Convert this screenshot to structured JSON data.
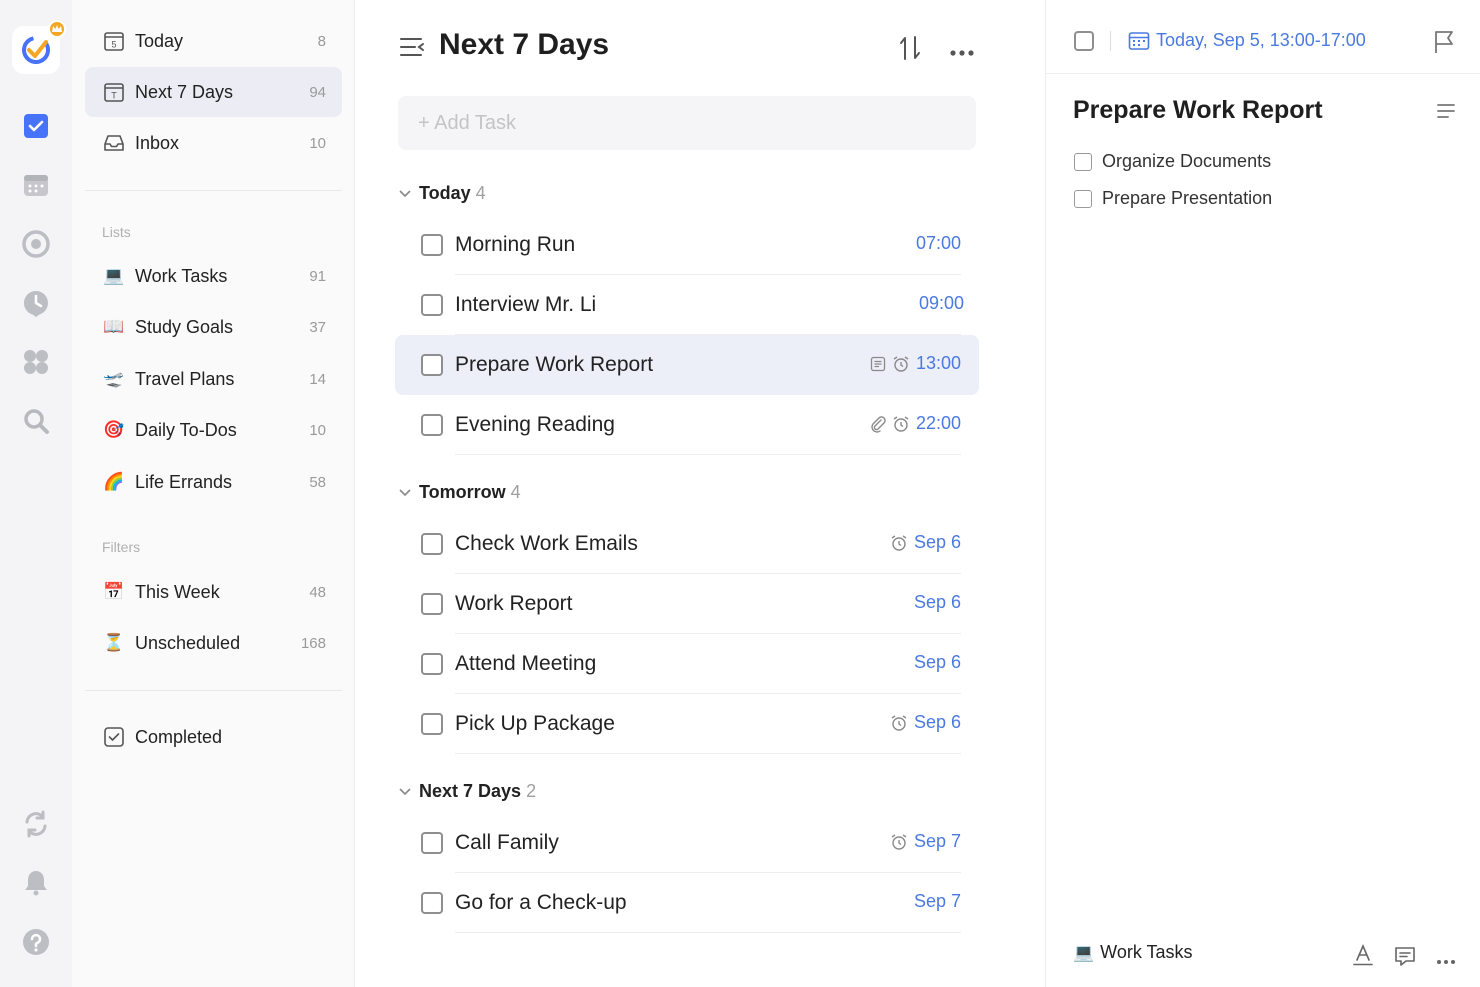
{
  "sidebar": {
    "smart": [
      {
        "label": "Today",
        "count": "8",
        "icon_day": "5"
      },
      {
        "label": "Next 7 Days",
        "count": "94",
        "icon_day": "T"
      },
      {
        "label": "Inbox",
        "count": "10"
      }
    ],
    "lists_title": "Lists",
    "lists": [
      {
        "emoji": "💻",
        "label": "Work Tasks",
        "count": "91"
      },
      {
        "emoji": "📖",
        "label": "Study Goals",
        "count": "37"
      },
      {
        "emoji": "🛫",
        "label": "Travel Plans",
        "count": "14"
      },
      {
        "emoji": "🎯",
        "label": "Daily To-Dos",
        "count": "10"
      },
      {
        "emoji": "🌈",
        "label": "Life Errands",
        "count": "58"
      }
    ],
    "filters_title": "Filters",
    "filters": [
      {
        "emoji": "📅",
        "label": "This Week",
        "count": "48"
      },
      {
        "emoji": "⏳",
        "label": "Unscheduled",
        "count": "168"
      }
    ],
    "completed_label": "Completed"
  },
  "main": {
    "title": "Next 7 Days",
    "add_task_placeholder": "+ Add Task",
    "groups": [
      {
        "label": "Today",
        "count": "4",
        "tasks": [
          {
            "title": "Morning Run",
            "time": "07:00"
          },
          {
            "title": "Interview Mr. Li",
            "time": "09:00"
          },
          {
            "title": "Prepare Work Report",
            "time": "13:00"
          },
          {
            "title": "Evening Reading",
            "time": "22:00"
          }
        ]
      },
      {
        "label": "Tomorrow",
        "count": "4",
        "tasks": [
          {
            "title": "Check Work Emails",
            "time": "Sep 6"
          },
          {
            "title": "Work Report",
            "time": "Sep 6"
          },
          {
            "title": "Attend Meeting",
            "time": "Sep 6"
          },
          {
            "title": "Pick Up Package",
            "time": "Sep 6"
          }
        ]
      },
      {
        "label": "Next 7 Days",
        "count": "2",
        "tasks": [
          {
            "title": "Call Family",
            "time": "Sep 7"
          },
          {
            "title": "Go for a Check-up",
            "time": "Sep 7"
          }
        ]
      }
    ]
  },
  "detail": {
    "date": "Today, Sep 5, 13:00-17:00",
    "title": "Prepare Work Report",
    "subtasks": [
      "Organize Documents",
      "Prepare Presentation"
    ],
    "list_emoji": "💻",
    "list_name": "Work Tasks"
  },
  "colors": {
    "accent": "#4a7ae0",
    "brand": "#4772fa",
    "selected_bg": "#eceef8"
  }
}
